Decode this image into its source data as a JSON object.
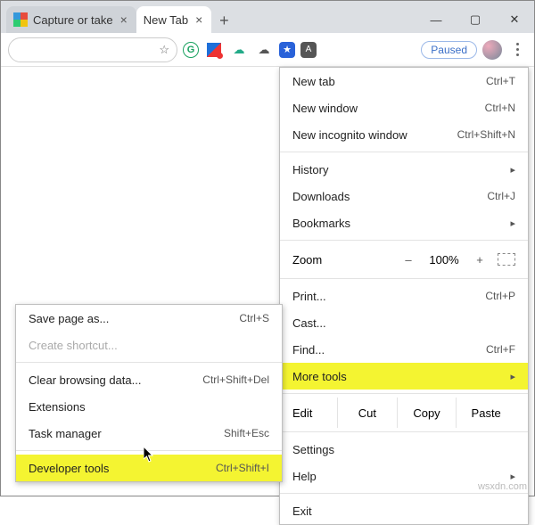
{
  "tabs": [
    {
      "title": "Capture or take",
      "active": false
    },
    {
      "title": "New Tab",
      "active": true
    }
  ],
  "window_controls": {
    "minimize": "—",
    "maximize": "▢",
    "close": "✕"
  },
  "toolbar": {
    "star": "☆",
    "grammarly": "G",
    "cloud1": "☁",
    "cloud2": "☁",
    "bookmark": "★",
    "pdf": "A",
    "paused_label": "Paused"
  },
  "menu": {
    "new_tab": {
      "label": "New tab",
      "shortcut": "Ctrl+T"
    },
    "new_window": {
      "label": "New window",
      "shortcut": "Ctrl+N"
    },
    "new_incognito": {
      "label": "New incognito window",
      "shortcut": "Ctrl+Shift+N"
    },
    "history": {
      "label": "History"
    },
    "downloads": {
      "label": "Downloads",
      "shortcut": "Ctrl+J"
    },
    "bookmarks": {
      "label": "Bookmarks"
    },
    "zoom": {
      "label": "Zoom",
      "minus": "–",
      "value": "100%",
      "plus": "+"
    },
    "print": {
      "label": "Print...",
      "shortcut": "Ctrl+P"
    },
    "cast": {
      "label": "Cast..."
    },
    "find": {
      "label": "Find...",
      "shortcut": "Ctrl+F"
    },
    "more_tools": {
      "label": "More tools"
    },
    "edit": {
      "label": "Edit",
      "cut": "Cut",
      "copy": "Copy",
      "paste": "Paste"
    },
    "settings": {
      "label": "Settings"
    },
    "help": {
      "label": "Help"
    },
    "exit": {
      "label": "Exit"
    }
  },
  "submenu": {
    "save_as": {
      "label": "Save page as...",
      "shortcut": "Ctrl+S"
    },
    "create_shortcut": {
      "label": "Create shortcut..."
    },
    "clear_data": {
      "label": "Clear browsing data...",
      "shortcut": "Ctrl+Shift+Del"
    },
    "extensions": {
      "label": "Extensions"
    },
    "task_manager": {
      "label": "Task manager",
      "shortcut": "Shift+Esc"
    },
    "dev_tools": {
      "label": "Developer tools",
      "shortcut": "Ctrl+Shift+I"
    }
  },
  "watermark": "wsxdn.com"
}
